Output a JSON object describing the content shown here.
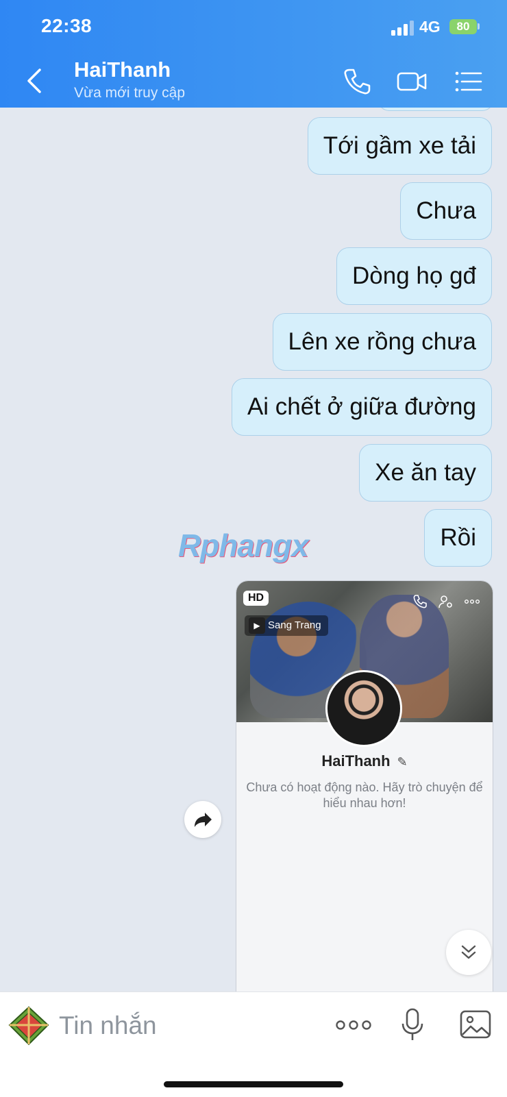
{
  "status_bar": {
    "time": "22:38",
    "network": "4G",
    "battery": "80"
  },
  "header": {
    "title": "HaiThanh",
    "subtitle": "Vừa mới truy cập",
    "icons": [
      "back-icon",
      "phone-icon",
      "video-call-icon",
      "menu-list-icon"
    ]
  },
  "messages": [
    {
      "text": "Tới gầm xe tải"
    },
    {
      "text": "Chưa"
    },
    {
      "text": "Dòng họ gđ"
    },
    {
      "text": "Lên xe rồng chưa"
    },
    {
      "text": "Ai chết ở giữa đường"
    },
    {
      "text": "Xe ăn tay"
    },
    {
      "text": "Rồi"
    }
  ],
  "watermark": "Rphangx",
  "profile_card": {
    "hd_badge": "HD",
    "music": "Sang Trang",
    "name": "HaiThanh",
    "description": "Chưa có hoạt động nào. Hãy trò chuyện để hiểu nhau hơn!"
  },
  "input": {
    "placeholder": "Tin nhắn"
  },
  "colors": {
    "header_start": "#2f87f3",
    "header_end": "#4aa0f1",
    "bubble_bg": "#d6effb",
    "bubble_border": "#abd0e9",
    "chat_bg": "#e3e8f0"
  }
}
